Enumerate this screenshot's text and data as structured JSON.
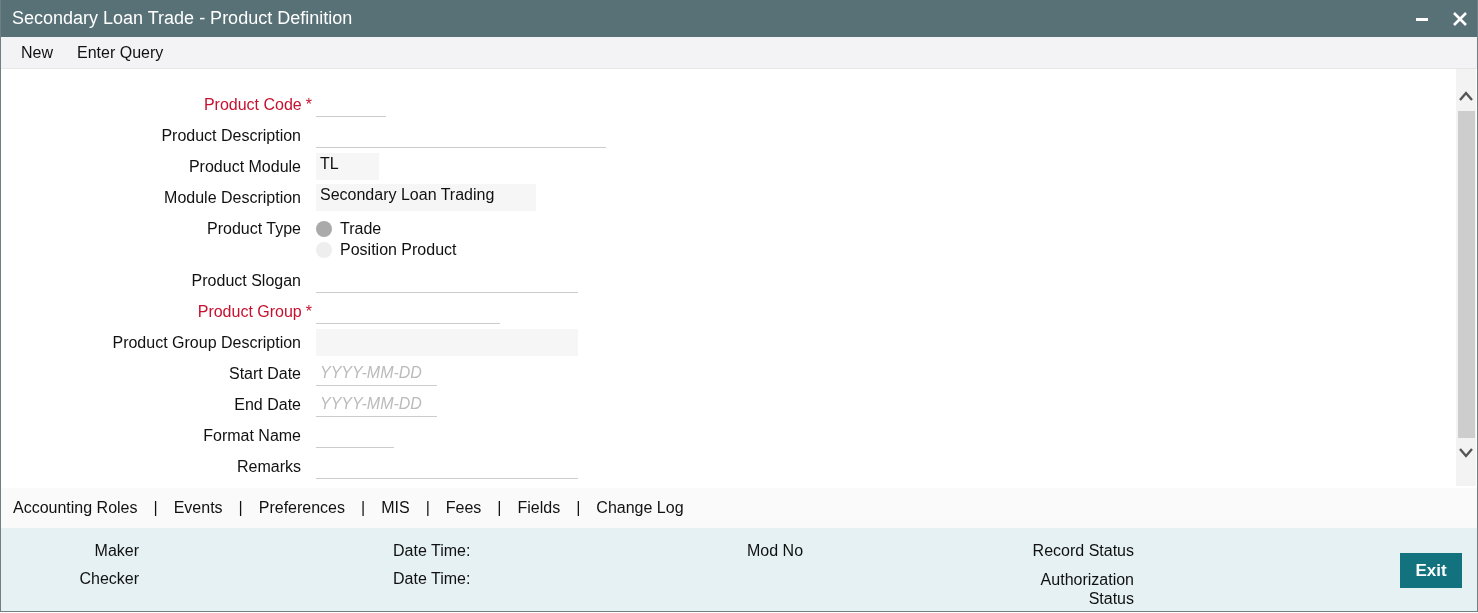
{
  "window": {
    "title": "Secondary Loan Trade - Product Definition",
    "controls": [
      {
        "kind": "minimize"
      },
      {
        "kind": "close"
      }
    ]
  },
  "toolbar": [
    "New",
    "Enter Query"
  ],
  "form": [
    {
      "kind": "text",
      "label": "Product Code",
      "required": true,
      "mark": "*"
    },
    {
      "kind": "text",
      "label": "Product Description",
      "required": false
    },
    {
      "kind": "readonly",
      "label": "Product Module",
      "required": false,
      "value": "TL"
    },
    {
      "kind": "readonly",
      "label": "Module Description",
      "required": false,
      "value": "Secondary Loan Trading"
    },
    {
      "kind": "radio",
      "label": "Product Type",
      "required": false,
      "options": [
        {
          "label": "Trade",
          "selected": true
        },
        {
          "label": "Position Product",
          "selected": false
        }
      ]
    },
    {
      "kind": "text",
      "label": "Product Slogan",
      "required": false
    },
    {
      "kind": "text",
      "label": "Product Group",
      "required": true,
      "mark": "*"
    },
    {
      "kind": "readonly",
      "label": "Product Group Description",
      "required": false
    },
    {
      "kind": "text",
      "label": "Start Date",
      "required": false,
      "placeholder": "YYYY-MM-DD"
    },
    {
      "kind": "text",
      "label": "End Date",
      "required": false,
      "placeholder": "YYYY-MM-DD"
    },
    {
      "kind": "text",
      "label": "Format Name",
      "required": false
    },
    {
      "kind": "text",
      "label": "Remarks",
      "required": false
    }
  ],
  "subsystems": {
    "items": [
      "Accounting Roles",
      "Events",
      "Preferences",
      "MIS",
      "Fees",
      "Fields",
      "Change Log"
    ],
    "separator": "|"
  },
  "audit": {
    "maker": "Maker",
    "checker": "Checker",
    "date_time_1": "Date Time:",
    "date_time_2": "Date Time:",
    "mod_no": "Mod No",
    "record_status": "Record Status",
    "authorization_status": "Authorization Status"
  },
  "exit_button": "Exit"
}
